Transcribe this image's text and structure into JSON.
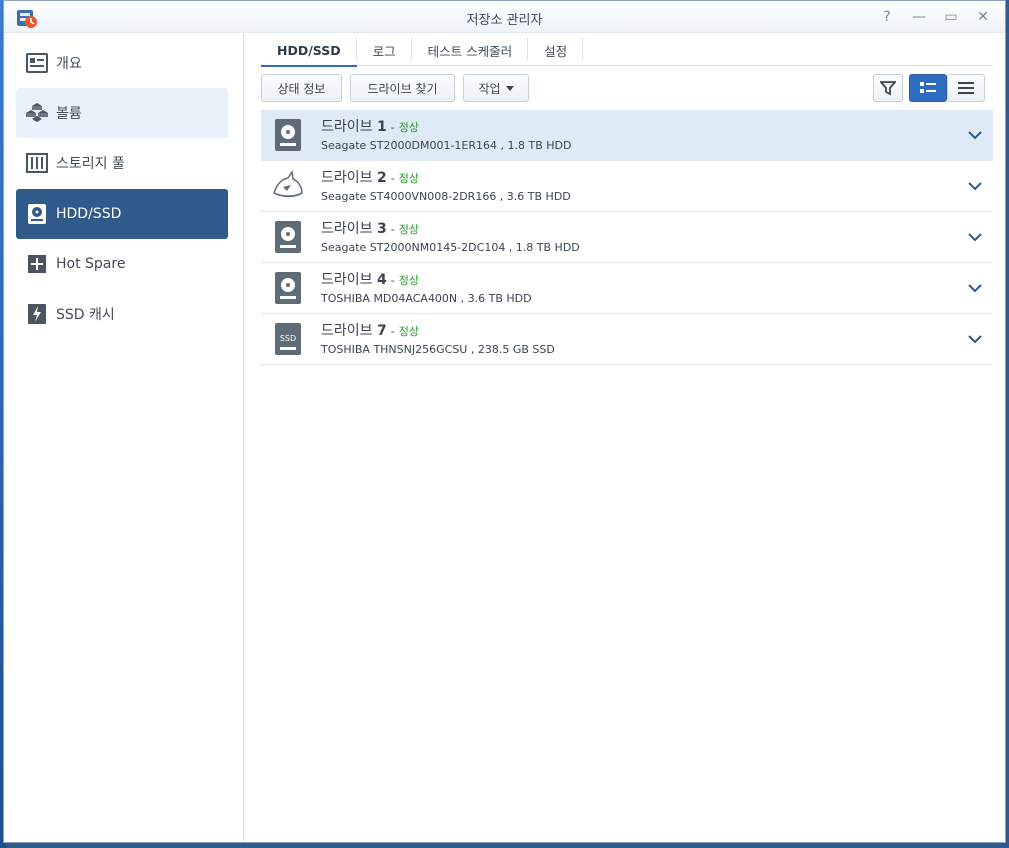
{
  "window": {
    "title": "저장소 관리자",
    "buttons": [
      "?",
      "—",
      "▭",
      "✕"
    ]
  },
  "sidebar": {
    "items": [
      {
        "label": "개요",
        "icon": "overview-icon"
      },
      {
        "label": "볼륨",
        "icon": "volume-icon"
      },
      {
        "label": "스토리지 풀",
        "icon": "storage-pool-icon"
      },
      {
        "label": "HDD/SSD",
        "icon": "hdd-icon"
      },
      {
        "label": "Hot Spare",
        "icon": "hot-spare-icon"
      },
      {
        "label": "SSD 캐시",
        "icon": "ssd-cache-icon"
      }
    ]
  },
  "tabs": [
    "HDD/SSD",
    "로그",
    "테스트 스케줄러",
    "설정"
  ],
  "toolbar": {
    "status_info": "상태 정보",
    "find_drive": "드라이브 찾기",
    "action": "작업"
  },
  "drives": [
    {
      "name": "드라이브",
      "num": "1",
      "dash": "-",
      "status": "정상",
      "model": "Seagate ST2000DM001-1ER164 , 1.8 TB HDD",
      "icon": "hdd-icon"
    },
    {
      "name": "드라이브",
      "num": "2",
      "dash": "-",
      "status": "정상",
      "model": "Seagate ST4000VN008-2DR166 , 3.6 TB HDD",
      "icon": "ironwolf-icon"
    },
    {
      "name": "드라이브",
      "num": "3",
      "dash": "-",
      "status": "정상",
      "model": "Seagate ST2000NM0145-2DC104 , 1.8 TB HDD",
      "icon": "hdd-icon"
    },
    {
      "name": "드라이브",
      "num": "4",
      "dash": "-",
      "status": "정상",
      "model": "TOSHIBA MD04ACA400N , 3.6 TB HDD",
      "icon": "hdd-icon"
    },
    {
      "name": "드라이브",
      "num": "7",
      "dash": "-",
      "status": "정상",
      "model": "TOSHIBA THNSNJ256GCSU , 238.5 GB SSD",
      "icon": "ssd-icon",
      "icon_text": "SSD"
    }
  ],
  "colors": {
    "accent": "#2f5a8a",
    "selected_row": "#dfeaf7",
    "status_ok": "#2e9a2e"
  }
}
